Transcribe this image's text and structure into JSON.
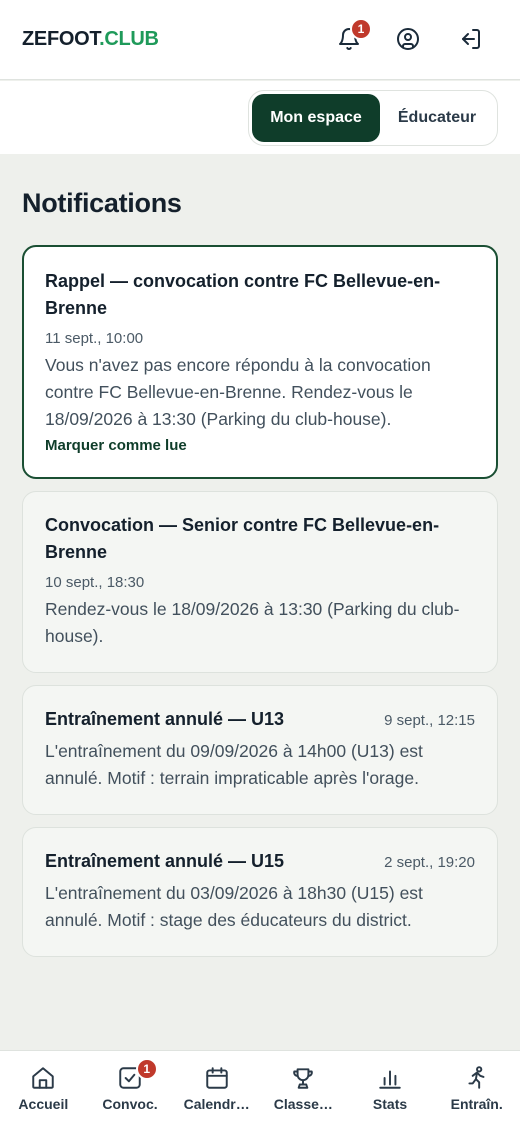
{
  "header": {
    "brand_part1": "ZEFOOT",
    "brand_part2": ".CLUB",
    "notification_count": "1"
  },
  "space_switch": {
    "active_label": "Mon espace",
    "other_label": "Éducateur"
  },
  "page": {
    "title": "Notifications"
  },
  "notifications": [
    {
      "title": "Rappel — convocation contre FC Bellevue-en-Brenne",
      "date": "11 sept., 10:00",
      "body": "Vous n'avez pas encore répondu à la convocation contre FC Bellevue-en-Brenne. Rendez-vous le 18/09/2026 à 13:30 (Parking du club-house).",
      "action": "Marquer comme lue"
    },
    {
      "title": "Convocation — Senior contre FC Bellevue-en-Brenne",
      "date": "10 sept., 18:30",
      "body": "Rendez-vous le 18/09/2026 à 13:30 (Parking du club-house)."
    },
    {
      "title": "Entraînement annulé — U13",
      "date": "9 sept., 12:15",
      "body": "L'entraînement du 09/09/2026 à 14h00 (U13) est annulé. Motif : terrain impraticable après l'orage."
    },
    {
      "title": "Entraînement annulé — U15",
      "date": "2 sept., 19:20",
      "body": "L'entraînement du 03/09/2026 à 18h30 (U15) est annulé. Motif : stage des éducateurs du district."
    }
  ],
  "bottom_nav": {
    "items": [
      {
        "label": "Accueil",
        "icon": "home-icon"
      },
      {
        "label": "Convoc.",
        "icon": "checkbox-icon",
        "badge": "1"
      },
      {
        "label": "Calendr…",
        "icon": "calendar-icon"
      },
      {
        "label": "Classe…",
        "icon": "trophy-icon"
      },
      {
        "label": "Stats",
        "icon": "bar-chart-icon"
      },
      {
        "label": "Entraîn.",
        "icon": "runner-icon"
      }
    ]
  },
  "colors": {
    "brand_accent": "#1f9a5a",
    "primary_dark": "#0f3d2a",
    "badge_red": "#c0392b",
    "background": "#eef0ec"
  }
}
